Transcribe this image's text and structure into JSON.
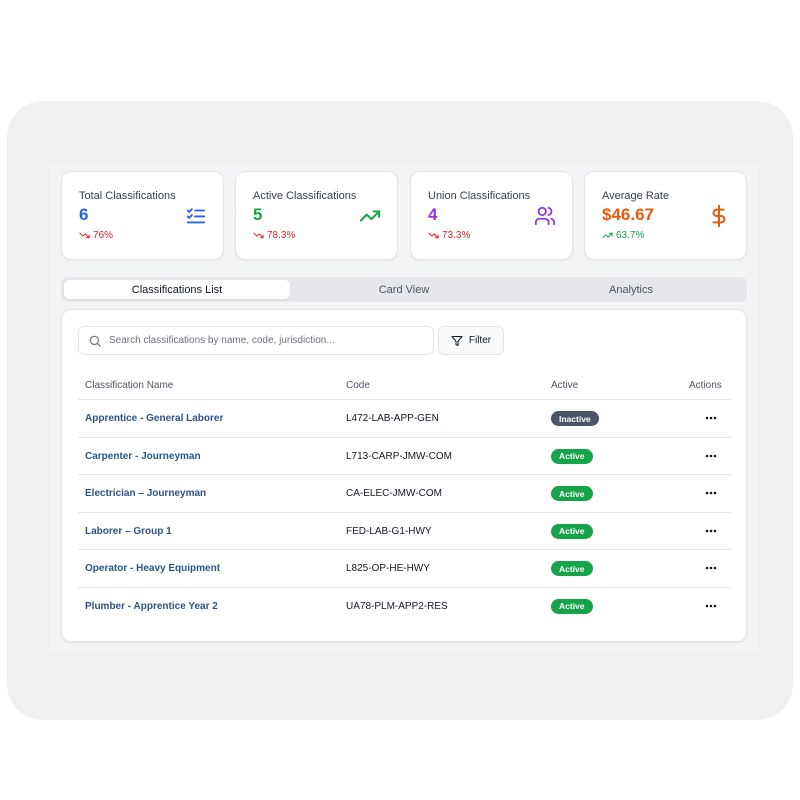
{
  "stats": [
    {
      "title": "Total Classifications",
      "value": "6",
      "trend": "76%",
      "trend_direction": "down",
      "value_color": "#2563eb",
      "trend_color": "#dc2626",
      "icon": "checklist-icon",
      "icon_color": "#2563eb"
    },
    {
      "title": "Active Classifications",
      "value": "5",
      "trend": "78.3%",
      "trend_direction": "down",
      "value_color": "#16a34a",
      "trend_color": "#dc2626",
      "icon": "trending-up-icon",
      "icon_color": "#16a34a"
    },
    {
      "title": "Union Classifications",
      "value": "4",
      "trend": "73.3%",
      "trend_direction": "down",
      "value_color": "#9333ea",
      "trend_color": "#dc2626",
      "icon": "users-icon",
      "icon_color": "#9333ea"
    },
    {
      "title": "Average Rate",
      "value": "$46.67",
      "trend": "63.7%",
      "trend_direction": "up",
      "value_color": "#ea580c",
      "trend_color": "#16a34a",
      "icon": "dollar-icon",
      "icon_color": "#ea580c"
    }
  ],
  "tabs": [
    {
      "label": "Classifications List",
      "active": true
    },
    {
      "label": "Card View",
      "active": false
    },
    {
      "label": "Analytics",
      "active": false
    }
  ],
  "search": {
    "placeholder": "Search classifications by name, code, jurisdiction...",
    "value": ""
  },
  "filter_label": "Filter",
  "table": {
    "headers": {
      "name": "Classification Name",
      "code": "Code",
      "active": "Active",
      "actions": "Actions"
    },
    "rows": [
      {
        "name": "Apprentice - General Laborer",
        "code": "L472-LAB-APP-GEN",
        "status": "Inactive"
      },
      {
        "name": "Carpenter - Journeyman",
        "code": "L713-CARP-JMW-COM",
        "status": "Active"
      },
      {
        "name": "Electrician – Journeyman",
        "code": "CA-ELEC-JMW-COM",
        "status": "Active"
      },
      {
        "name": "Laborer – Group 1",
        "code": "FED-LAB-G1-HWY",
        "status": "Active"
      },
      {
        "name": "Operator - Heavy Equipment",
        "code": "L825-OP-HE-HWY",
        "status": "Active"
      },
      {
        "name": "Plumber - Apprentice Year 2",
        "code": "UA78-PLM-APP2-RES",
        "status": "Active"
      }
    ]
  },
  "colors": {
    "active_badge": "#16a34a",
    "inactive_badge": "#4b5563",
    "link": "#2b5489"
  }
}
